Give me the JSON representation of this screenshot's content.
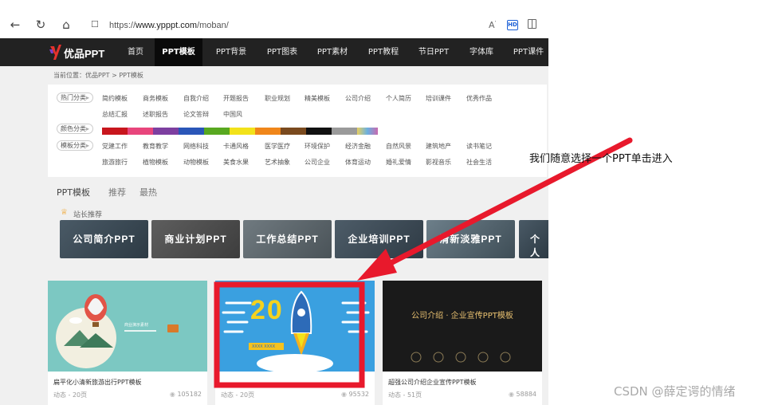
{
  "browser": {
    "url_prefix": "https://",
    "url_host": "www.ypppt.com",
    "url_path": "/moban/",
    "nav_icons": [
      "back-icon",
      "refresh-icon",
      "home-icon"
    ],
    "right_icons": [
      "read-aloud-icon",
      "hd-icon",
      "split-screen-icon"
    ],
    "read_aloud_glyph": "A",
    "hd_label": "HD"
  },
  "site": {
    "logo_text": "优品PPT",
    "nav": [
      "首页",
      "PPT模板",
      "PPT背景",
      "PPT图表",
      "PPT素材",
      "PPT教程",
      "节日PPT",
      "字体库",
      "PPT课件"
    ],
    "active_nav": "PPT模板"
  },
  "breadcrumb": "当前位置：优品PPT > PPT模板",
  "filters": {
    "hot_label": "热门分类",
    "hot_row1": [
      "简约模板",
      "商务模板",
      "自我介绍",
      "开题报告",
      "职业规划",
      "精美模板",
      "公司介绍",
      "个人简历",
      "培训课件",
      "优秀作品"
    ],
    "hot_row2": [
      "总结汇报",
      "述职报告",
      "论文答辩",
      "中国风"
    ],
    "color_label": "颜色分类",
    "colors": [
      "#c8161d",
      "#e8457c",
      "#7d3fa0",
      "#2a56b8",
      "#58a820",
      "#f2e21a",
      "#f0861a",
      "#7a4a1e",
      "#111111",
      "#9a9a9a",
      "#6ab0e0"
    ],
    "template_label": "模板分类",
    "tpl_row1": [
      "党建工作",
      "教育教学",
      "网络科技",
      "卡通风格",
      "医学医疗",
      "环境保护",
      "经济金融",
      "自然风景",
      "建筑地产",
      "读书笔记"
    ],
    "tpl_row2": [
      "旅游旅行",
      "植物模板",
      "动物模板",
      "美食水果",
      "艺术抽象",
      "公司企业",
      "体育运动",
      "婚礼爱情",
      "影视音乐",
      "社会生活"
    ]
  },
  "tabs": [
    "PPT模板",
    "推荐",
    "最热"
  ],
  "recommend": {
    "title": "站长推荐",
    "banners": [
      "公司简介PPT",
      "商业计划PPT",
      "工作总结PPT",
      "企业培训PPT",
      "清新淡雅PPT",
      "个人"
    ]
  },
  "cards": [
    {
      "title": "扁平化小清新旅游出行PPT模板",
      "meta": "动态 - 20页",
      "views": "105182",
      "inner_text": "商业演示素材"
    },
    {
      "title": "",
      "meta": "动态 - 20页",
      "views": "95532",
      "inner_year": "20",
      "inner_badge": "XXXX XXXX"
    },
    {
      "title": "超强公司介绍企业宣传PPT模板",
      "meta": "动态 - 51页",
      "views": "58884",
      "inner_title": "公司介绍 · 企业宣传PPT模板"
    }
  ],
  "annotation": "我们随意选择一个PPT单击进入",
  "annotation_color": "#e8192c",
  "watermark": "CSDN @薛定谔的情绪"
}
